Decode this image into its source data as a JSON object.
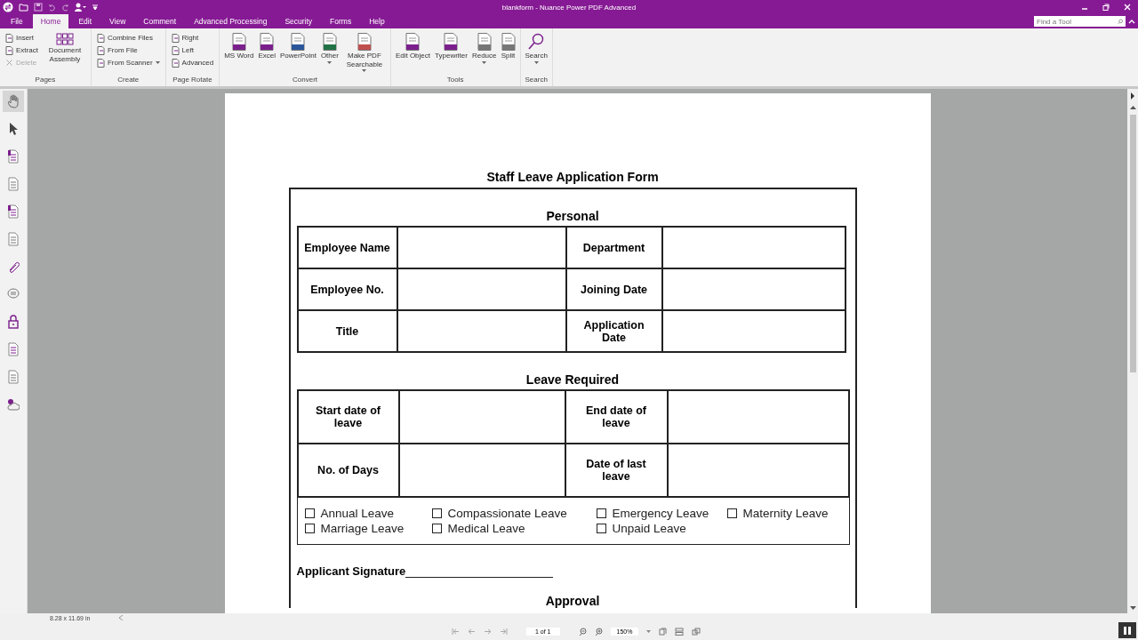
{
  "window": {
    "title": "blankform - Nuance Power PDF Advanced"
  },
  "menu_tabs": [
    {
      "label": "File",
      "selected": false
    },
    {
      "label": "Home",
      "selected": true
    },
    {
      "label": "Edit",
      "selected": false
    },
    {
      "label": "View",
      "selected": false
    },
    {
      "label": "Comment",
      "selected": false
    },
    {
      "label": "Advanced Processing",
      "selected": false
    },
    {
      "label": "Security",
      "selected": false
    },
    {
      "label": "Forms",
      "selected": false
    },
    {
      "label": "Help",
      "selected": false
    }
  ],
  "find_tool": {
    "placeholder": "Find a Tool"
  },
  "ribbon_groups": [
    {
      "label": "Pages",
      "items": [
        {
          "kind": "small",
          "label": "Insert",
          "disabled": false
        },
        {
          "kind": "small",
          "label": "Extract",
          "disabled": false
        },
        {
          "kind": "small",
          "label": "Delete",
          "disabled": true
        },
        {
          "kind": "large",
          "label": "Document Assembly",
          "dropdown": false
        }
      ]
    },
    {
      "label": "Create",
      "items": [
        {
          "kind": "small",
          "label": "Combine Files",
          "disabled": false
        },
        {
          "kind": "small",
          "label": "From File",
          "disabled": false
        },
        {
          "kind": "small",
          "label": "From Scanner",
          "disabled": false,
          "dropdown": true
        }
      ]
    },
    {
      "label": "Page Rotate",
      "items": [
        {
          "kind": "small",
          "label": "Right",
          "disabled": false
        },
        {
          "kind": "small",
          "label": "Left",
          "disabled": false
        },
        {
          "kind": "small",
          "label": "Advanced",
          "disabled": false
        }
      ]
    },
    {
      "label": "Convert",
      "items": [
        {
          "kind": "large",
          "label": "MS Word",
          "dropdown": false
        },
        {
          "kind": "large",
          "label": "Excel",
          "dropdown": false
        },
        {
          "kind": "large",
          "label": "PowerPoint",
          "dropdown": false
        },
        {
          "kind": "large",
          "label": "Other",
          "dropdown": true
        },
        {
          "kind": "large",
          "label": "Make PDF Searchable",
          "dropdown": true
        }
      ]
    },
    {
      "label": "Tools",
      "items": [
        {
          "kind": "large",
          "label": "Edit Object",
          "dropdown": false
        },
        {
          "kind": "large",
          "label": "Typewriter",
          "dropdown": false
        },
        {
          "kind": "large",
          "label": "Reduce",
          "dropdown": true
        },
        {
          "kind": "large",
          "label": "Split",
          "dropdown": false
        }
      ]
    },
    {
      "label": "Search",
      "items": [
        {
          "kind": "large",
          "label": "Search",
          "dropdown": true
        }
      ]
    }
  ],
  "sidebar_tools": [
    {
      "selected": true
    },
    {
      "selected": false
    },
    {
      "selected": false
    },
    {
      "selected": false
    },
    {
      "selected": false
    },
    {
      "selected": false
    },
    {
      "selected": false
    },
    {
      "selected": false
    },
    {
      "selected": false
    },
    {
      "selected": false
    },
    {
      "selected": false
    },
    {
      "selected": false
    }
  ],
  "document": {
    "title": "Staff Leave Application Form",
    "sections": [
      {
        "heading": "Personal",
        "rows": [
          [
            "Employee Name",
            "",
            "Department",
            ""
          ],
          [
            "Employee No.",
            "",
            "Joining Date",
            ""
          ],
          [
            "Title",
            "",
            "Application Date",
            ""
          ]
        ]
      },
      {
        "heading": "Leave Required",
        "rows": [
          [
            "Start date of leave",
            "",
            "End date of leave",
            ""
          ],
          [
            "No. of Days",
            "",
            "Date of last leave",
            ""
          ]
        ]
      }
    ],
    "leave_types": [
      {
        "label": "Annual Leave",
        "checked": false
      },
      {
        "label": "Compassionate Leave",
        "checked": false
      },
      {
        "label": "Emergency Leave",
        "checked": false
      },
      {
        "label": "Maternity Leave",
        "checked": false
      },
      {
        "label": "Marriage Leave",
        "checked": false
      },
      {
        "label": "Medical Leave",
        "checked": false
      },
      {
        "label": "Unpaid Leave",
        "checked": false
      }
    ],
    "signature_label": "Applicant Signature",
    "next_heading": "Approval"
  },
  "status_bar": {
    "page_size": "8.28 x 11.69 in",
    "page_field": "1 of 1",
    "zoom": "150%"
  }
}
